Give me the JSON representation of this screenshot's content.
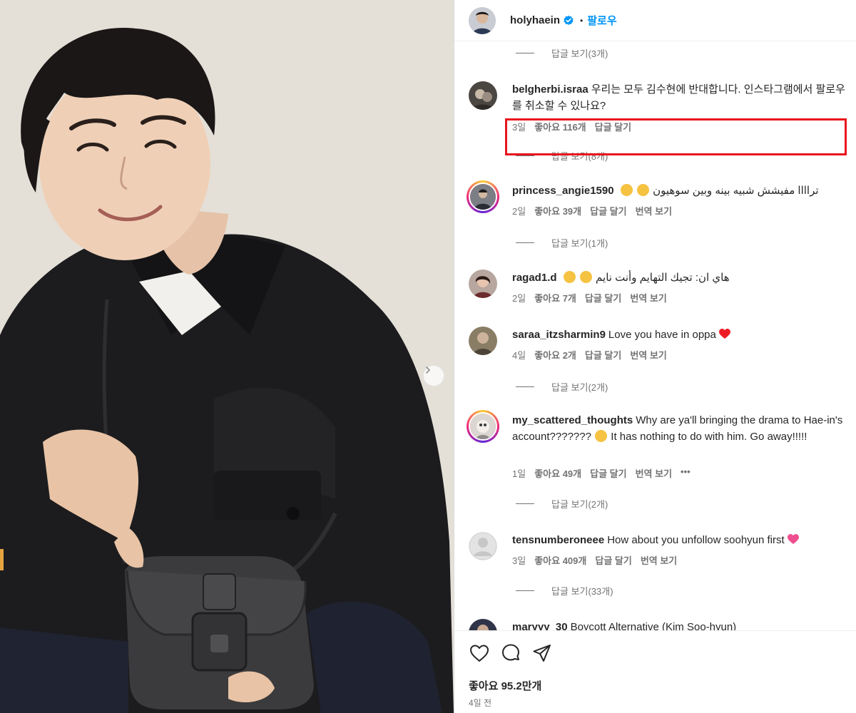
{
  "header": {
    "username": "holyhaein",
    "follow_label": "팔로우",
    "separator": "•"
  },
  "comments": {
    "reply_lines": [
      {
        "label": "답글 보기(3개)"
      },
      {
        "label": "답글 보기(8개)"
      },
      {
        "label": "답글 보기(1개)"
      },
      {
        "label": "답글 보기(2개)"
      },
      {
        "label": "답글 보기(2개)"
      },
      {
        "label": "답글 보기(33개)"
      }
    ],
    "items": [
      {
        "user": "belgherbi.israa",
        "text": "우리는 모두 김수현에 반대합니다. 인스타그램에서 팔로우를 취소할 수 있나요?",
        "time": "3일",
        "likes": "좋아요 116개",
        "reply": "답글 달기"
      },
      {
        "user": "princess_angie1590",
        "text": "تراااا مفيشش شبيه بينه وبين سوهيون",
        "time": "2일",
        "likes": "좋아요 39개",
        "reply": "답글 달기",
        "translate": "번역 보기"
      },
      {
        "user": "ragad1.d",
        "text": "هاي ان: تجيك التهايم وأنت نايم",
        "time": "2일",
        "likes": "좋아요 7개",
        "reply": "답글 달기",
        "translate": "번역 보기"
      },
      {
        "user": "saraa_itzsharmin9",
        "text": "Love you have in oppa",
        "time": "4일",
        "likes": "좋아요 2개",
        "reply": "답글 달기",
        "translate": "번역 보기"
      },
      {
        "user": "my_scattered_thoughts",
        "text": "Why are ya'll bringing the drama to Hae-in's account???????",
        "text2": "It has nothing to do with him. Go away!!!!!",
        "time": "1일",
        "likes": "좋아요 49개",
        "reply": "답글 달기",
        "translate": "번역 보기",
        "more": "•••"
      },
      {
        "user": "tensnumberoneee",
        "text": "How about you unfollow soohyun first",
        "time": "3일",
        "likes": "좋아요 409개",
        "reply": "답글 달기",
        "translate": "번역 보기"
      },
      {
        "user": "maryyy_30",
        "text": "Boycott Alternative (Kim Soo-hyun)"
      }
    ]
  },
  "footer": {
    "likes": "좋아요 95.2만개",
    "time_ago": "4일 전"
  },
  "icons": {
    "verified": "verified-badge-icon",
    "like": "heart-icon",
    "comment": "comment-icon",
    "share": "share-icon",
    "next": "chevron-right-icon"
  },
  "colors": {
    "accent": "#0095f6",
    "highlight": "#e8141c",
    "meta": "#737373"
  }
}
